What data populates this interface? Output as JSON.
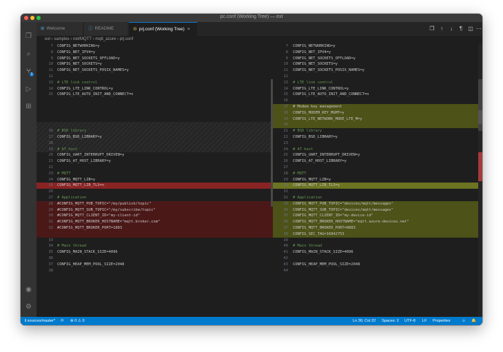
{
  "window": {
    "title": "pc.conf (Working Tree) — ext",
    "dots": [
      "#fe5f57",
      "#febc2e",
      "#28c840"
    ]
  },
  "activity_bar": {
    "icons": [
      "files-icon",
      "search-icon",
      "source-control-icon",
      "run-debug-icon",
      "extensions-icon",
      "account-icon",
      "settings-gear-icon"
    ],
    "scm_badge": "1"
  },
  "tabs": [
    {
      "label": "Welcome",
      "active": false
    },
    {
      "label": "README",
      "active": false
    },
    {
      "label": "prj.conf (Working Tree)",
      "active": true
    }
  ],
  "tab_close": "×",
  "toolbar_icons": [
    "open-changes-icon",
    "previous-change-icon",
    "next-change-icon",
    "stage-icon",
    "split-editor-icon",
    "more-actions-icon"
  ],
  "breadcrumb": "ext › samples › net/MQTT › mqtt_azure › prj.conf",
  "left_lines": [
    {
      "num": "7",
      "text": "CONFIG_NETWORKING=y",
      "kind": "normal"
    },
    {
      "num": "8",
      "text": "CONFIG_NET_IPV4=y",
      "kind": "normal"
    },
    {
      "num": "9",
      "text": "CONFIG_NET_SOCKETS_OFFLOAD=y",
      "kind": "normal"
    },
    {
      "num": "10",
      "text": "CONFIG_NET_SOCKETS=y",
      "kind": "normal"
    },
    {
      "num": "11",
      "text": "CONFIG_NET_SOCKETS_POSIX_NAMES=y",
      "kind": "normal"
    },
    {
      "num": "12",
      "text": "",
      "kind": "normal"
    },
    {
      "num": "13",
      "text": "# LTE link control",
      "kind": "comment"
    },
    {
      "num": "14",
      "text": "CONFIG_LTE_LINK_CONTROL=y",
      "kind": "normal"
    },
    {
      "num": "15",
      "text": "CONFIG_LTE_AUTO_INIT_AND_CONNECT=n",
      "kind": "normal"
    },
    {
      "num": "",
      "text": "",
      "kind": "gap"
    },
    {
      "num": "",
      "text": "",
      "kind": "gap"
    },
    {
      "num": "",
      "text": "",
      "kind": "gap"
    },
    {
      "num": "",
      "text": "",
      "kind": "gap"
    },
    {
      "num": "",
      "text": "",
      "kind": "gap"
    },
    {
      "num": "16",
      "text": "# BSD library",
      "kind": "comment"
    },
    {
      "num": "17",
      "text": "CONFIG_BSD_LIBRARY=y",
      "kind": "normal"
    },
    {
      "num": "18",
      "text": "",
      "kind": "normal"
    },
    {
      "num": "19",
      "text": "# AT host",
      "kind": "comment"
    },
    {
      "num": "20",
      "text": "CONFIG_UART_INTERRUPT_DRIVEN=y",
      "kind": "normal"
    },
    {
      "num": "21",
      "text": "CONFIG_AT_HOST_LIBRARY=y",
      "kind": "normal"
    },
    {
      "num": "22",
      "text": "",
      "kind": "normal"
    },
    {
      "num": "23",
      "text": "# MQTT",
      "kind": "comment"
    },
    {
      "num": "24",
      "text": "CONFIG_MQTT_LIB=y",
      "kind": "normal"
    },
    {
      "num": "25",
      "text": "CONFIG_MQTT_LIB_TLS=n",
      "kind": "removed-line"
    },
    {
      "num": "26",
      "text": "",
      "kind": "normal"
    },
    {
      "num": "27",
      "text": "# Application",
      "kind": "comment"
    },
    {
      "num": "28",
      "text": "#CONFIG_MQTT_PUB_TOPIC=\"/my/publish/topic\"",
      "kind": "removed"
    },
    {
      "num": "29",
      "text": "#CONFIG_MQTT_SUB_TOPIC=\"/my/subscribe/topic\"",
      "kind": "removed"
    },
    {
      "num": "30",
      "text": "#CONFIG_MQTT_CLIENT_ID=\"my-client-id\"",
      "kind": "removed"
    },
    {
      "num": "31",
      "text": "#CONFIG_MQTT_BROKER_HOSTNAME=\"mqtt.broker.com\"",
      "kind": "removed"
    },
    {
      "num": "32",
      "text": "#CONFIG_MQTT_BROKER_PORT=1883",
      "kind": "removed"
    },
    {
      "num": "",
      "text": "",
      "kind": "removed-empty"
    },
    {
      "num": "33",
      "text": "",
      "kind": "normal"
    },
    {
      "num": "34",
      "text": "# Main thread",
      "kind": "comment"
    },
    {
      "num": "35",
      "text": "CONFIG_MAIN_STACK_SIZE=4096",
      "kind": "normal"
    },
    {
      "num": "36",
      "text": "",
      "kind": "normal"
    },
    {
      "num": "37",
      "text": "CONFIG_HEAP_MEM_POOL_SIZE=2048",
      "kind": "normal"
    },
    {
      "num": "38",
      "text": "",
      "kind": "normal"
    }
  ],
  "right_lines": [
    {
      "num": "7",
      "text": "CONFIG_NETWORKING=y",
      "kind": "normal"
    },
    {
      "num": "8",
      "text": "CONFIG_NET_IPV4=y",
      "kind": "normal"
    },
    {
      "num": "9",
      "text": "CONFIG_NET_SOCKETS_OFFLOAD=y",
      "kind": "normal"
    },
    {
      "num": "10",
      "text": "CONFIG_NET_SOCKETS=y",
      "kind": "normal"
    },
    {
      "num": "11",
      "text": "CONFIG_NET_SOCKETS_POSIX_NAMES=y",
      "kind": "normal"
    },
    {
      "num": "12",
      "text": "",
      "kind": "normal"
    },
    {
      "num": "13",
      "text": "# LTE link control",
      "kind": "comment"
    },
    {
      "num": "14",
      "text": "CONFIG_LTE_LINK_CONTROL=y",
      "kind": "normal"
    },
    {
      "num": "15",
      "text": "CONFIG_LTE_AUTO_INIT_AND_CONNECT=n",
      "kind": "normal"
    },
    {
      "num": "16",
      "text": "",
      "kind": "normal"
    },
    {
      "num": "17",
      "text": "# Modem key management",
      "kind": "added"
    },
    {
      "num": "18",
      "text": "CONFIG_MODEM_KEY_MGMT=y",
      "kind": "added"
    },
    {
      "num": "19",
      "text": "CONFIG_LTE_NETWORK_MODE_LTE_M=y",
      "kind": "added"
    },
    {
      "num": "20",
      "text": "",
      "kind": "added"
    },
    {
      "num": "21",
      "text": "# BSD library",
      "kind": "comment"
    },
    {
      "num": "22",
      "text": "CONFIG_BSD_LIBRARY=y",
      "kind": "normal"
    },
    {
      "num": "23",
      "text": "",
      "kind": "normal"
    },
    {
      "num": "24",
      "text": "# AT host",
      "kind": "comment"
    },
    {
      "num": "25",
      "text": "CONFIG_UART_INTERRUPT_DRIVEN=y",
      "kind": "normal"
    },
    {
      "num": "26",
      "text": "CONFIG_AT_HOST_LIBRARY=y",
      "kind": "normal"
    },
    {
      "num": "27",
      "text": "",
      "kind": "normal"
    },
    {
      "num": "28",
      "text": "# MQTT",
      "kind": "comment"
    },
    {
      "num": "29",
      "text": "CONFIG_MQTT_LIB=y",
      "kind": "normal"
    },
    {
      "num": "30",
      "text": "CONFIG_MQTT_LIB_TLS=y",
      "kind": "added-line"
    },
    {
      "num": "31",
      "text": "",
      "kind": "normal"
    },
    {
      "num": "32",
      "text": "# Application",
      "kind": "comment"
    },
    {
      "num": "33",
      "text": "CONFIG_MQTT_PUB_TOPIC=\"devices/mqtt/messages\"",
      "kind": "added"
    },
    {
      "num": "34",
      "text": "CONFIG_MQTT_SUB_TOPIC=\"devices/mqtt/messages\"",
      "kind": "added"
    },
    {
      "num": "35",
      "text": "CONFIG_MQTT_CLIENT_ID=\"my-device-id\"",
      "kind": "added"
    },
    {
      "num": "36",
      "text": "CONFIG_MQTT_BROKER_HOSTNAME=\"mqtt.azure-devices.net\"",
      "kind": "added"
    },
    {
      "num": "37",
      "text": "CONFIG_MQTT_BROKER_PORT=8883",
      "kind": "added"
    },
    {
      "num": "38",
      "text": "CONFIG_SEC_TAG=16842753",
      "kind": "added"
    },
    {
      "num": "39",
      "text": "",
      "kind": "normal"
    },
    {
      "num": "40",
      "text": "# Main thread",
      "kind": "comment"
    },
    {
      "num": "41",
      "text": "CONFIG_MAIN_STACK_SIZE=4096",
      "kind": "normal"
    },
    {
      "num": "42",
      "text": "",
      "kind": "normal"
    },
    {
      "num": "43",
      "text": "CONFIG_HEAP_MEM_POOL_SIZE=2048",
      "kind": "normal"
    },
    {
      "num": "44",
      "text": "",
      "kind": "normal"
    }
  ],
  "statusbar": {
    "branch": "ℹ sources/master*",
    "sync": "⟳",
    "problems": "⊗ 0 ⚠ 0",
    "cursor": "Ln 30, Col 22",
    "spaces": "Spaces: 2",
    "encoding": "UTF-8",
    "eol": "LF",
    "language": "Properties",
    "feedback": "☺",
    "bell": "🔔"
  },
  "colors": {
    "editor_bg": "#1e1e1e",
    "removed": "#4b1818",
    "added": "#4c5218",
    "statusbar": "#007acc",
    "accent": "#0e7ad3"
  }
}
